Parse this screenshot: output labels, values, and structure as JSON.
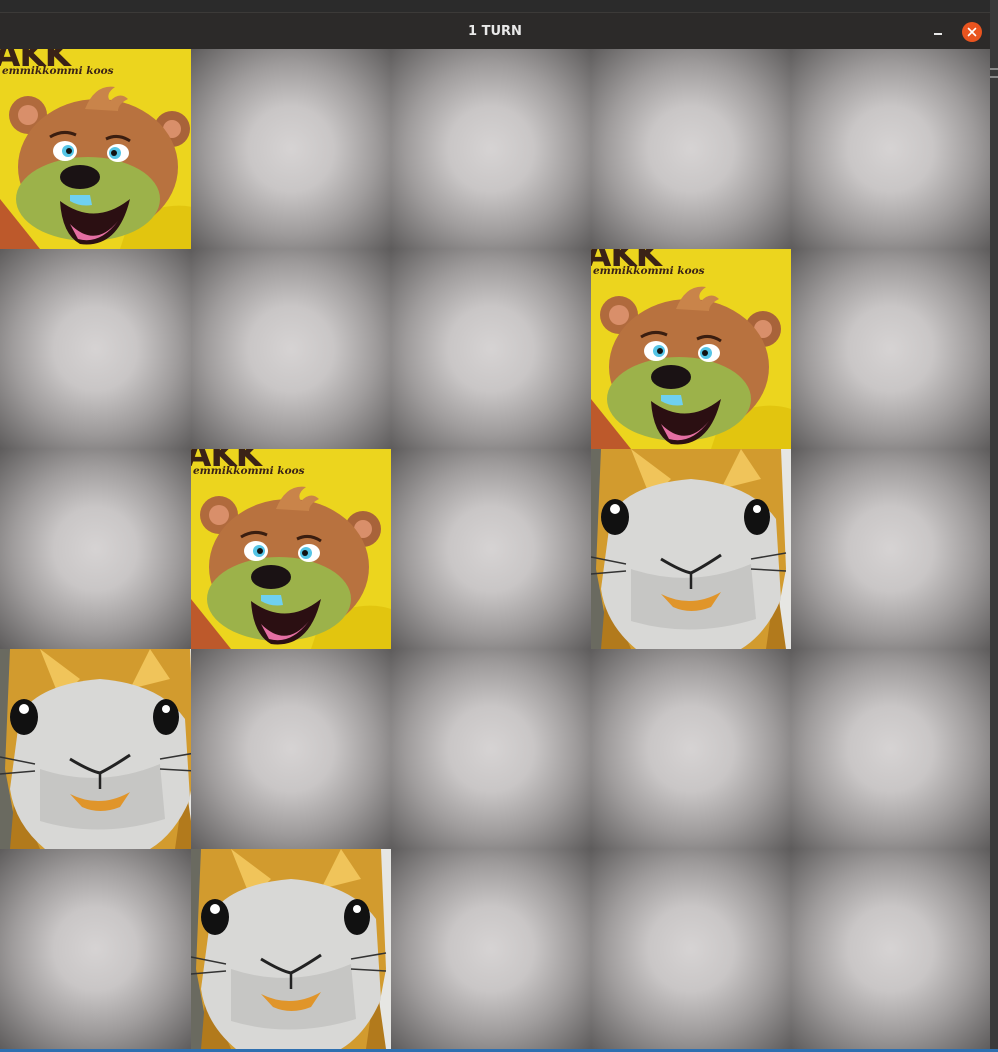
{
  "window": {
    "title": "1 TURN"
  },
  "board": {
    "rows": 5,
    "cols": 5,
    "tiles": [
      [
        "bear",
        "hidden",
        "hidden",
        "hidden",
        "hidden"
      ],
      [
        "hidden",
        "hidden",
        "hidden",
        "bear",
        "hidden"
      ],
      [
        "hidden",
        "bear",
        "hidden",
        "hamster",
        "hidden"
      ],
      [
        "hamster",
        "hidden",
        "hidden",
        "hidden",
        "hidden"
      ],
      [
        "hidden",
        "hamster",
        "hidden",
        "hidden",
        "hidden"
      ]
    ]
  },
  "bear_card": {
    "brand_text": "AKK",
    "slogan_text": "emmikkommi koos"
  },
  "icons": {
    "minimize": "minimize-icon",
    "close": "close-icon"
  },
  "colors": {
    "close_button": "#e9541f",
    "titlebar": "#2c2a29",
    "bear_background": "#e9d21f",
    "hamster_foil": "#d49a2c"
  }
}
